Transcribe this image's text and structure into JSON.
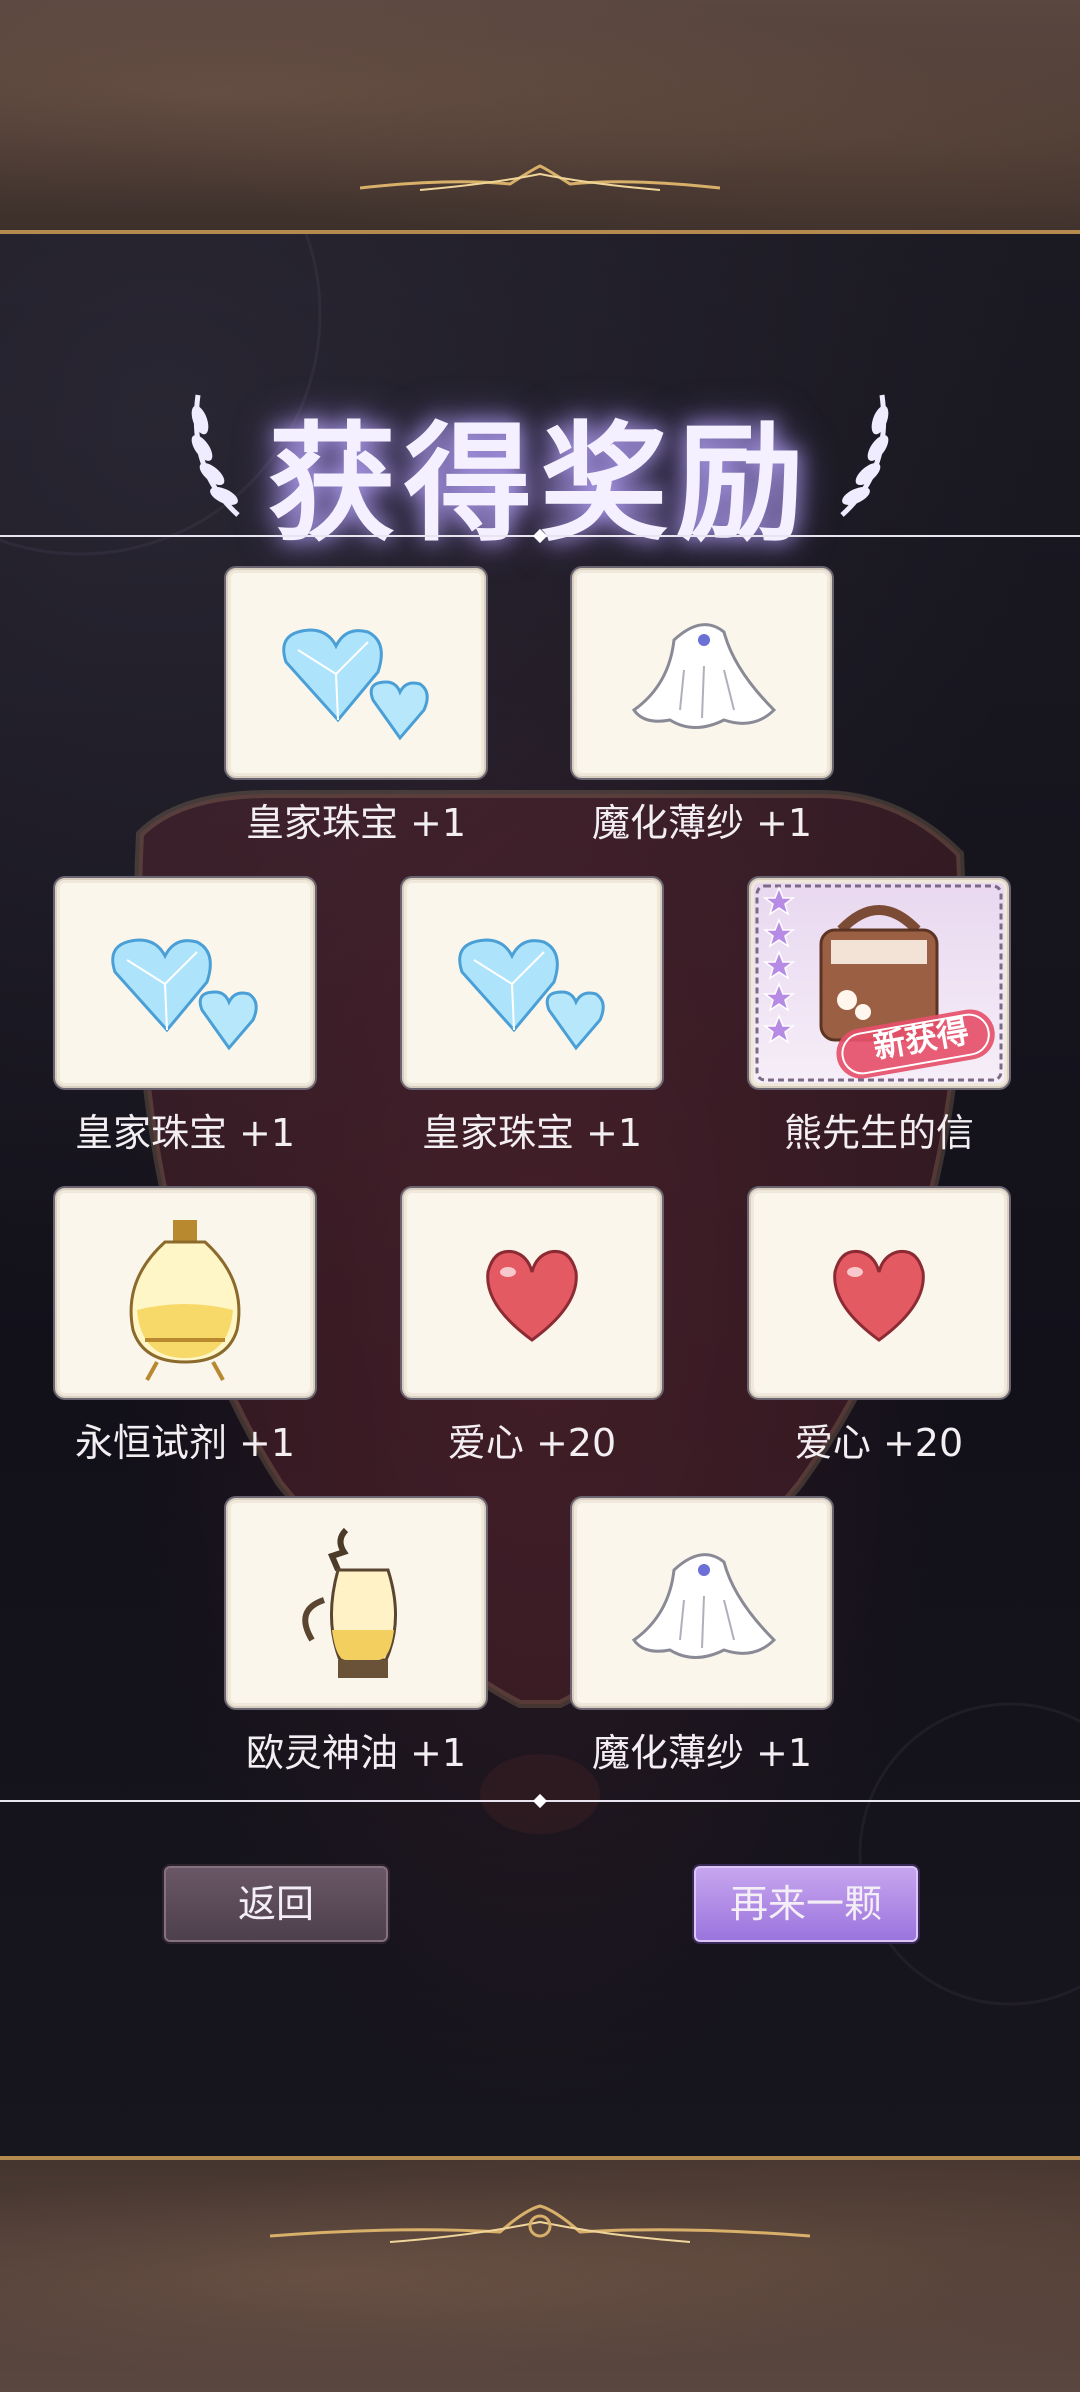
{
  "title": "获得奖励",
  "rewards": [
    {
      "name": "皇家珠宝 +1",
      "icon": "crystal-heart-icon"
    },
    {
      "name": "魔化薄纱 +1",
      "icon": "veil-icon"
    },
    {
      "name": "皇家珠宝 +1",
      "icon": "crystal-heart-icon"
    },
    {
      "name": "皇家珠宝 +1",
      "icon": "crystal-heart-icon"
    },
    {
      "name": "熊先生的信",
      "icon": "letter-bag-icon",
      "badge": "新获得",
      "stars": 5
    },
    {
      "name": "永恒试剂 +1",
      "icon": "potion-flask-icon"
    },
    {
      "name": "爱心 +20",
      "icon": "heart-icon"
    },
    {
      "name": "爱心 +20",
      "icon": "heart-icon"
    },
    {
      "name": "欧灵神油 +1",
      "icon": "oil-jug-icon"
    },
    {
      "name": "魔化薄纱 +1",
      "icon": "veil-icon"
    }
  ],
  "buttons": {
    "back": "返回",
    "again": "再来一颗"
  },
  "colors": {
    "accent_purple": "#a27de0",
    "gold_trim": "#b58a4e",
    "card_bg": "#fbf6ec"
  }
}
